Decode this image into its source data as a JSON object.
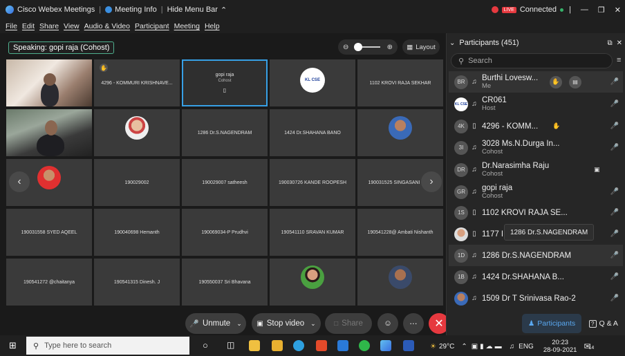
{
  "titlebar": {
    "app": "Cisco Webex Meetings",
    "meeting_info": "Meeting Info",
    "hide_menu": "Hide Menu Bar",
    "rec_badge": "LIVE",
    "status": "Connected"
  },
  "menu": [
    "File",
    "Edit",
    "Share",
    "View",
    "Audio & Video",
    "Participant",
    "Meeting",
    "Help"
  ],
  "speaking": "Speaking: gopi raja (Cohost)",
  "layout_label": "Layout",
  "tiles": [
    {
      "name": "",
      "kind": "video1"
    },
    {
      "name": "4296 - KOMMURI KRISHNAVE...",
      "kind": "name"
    },
    {
      "name": "gopi raja",
      "sub": "Cohost",
      "kind": "active"
    },
    {
      "name": "",
      "kind": "logo"
    },
    {
      "name": "1102 KROVI RAJA SEKHAR",
      "kind": "name"
    },
    {
      "name": "",
      "kind": "video2"
    },
    {
      "name": "",
      "kind": "avatar"
    },
    {
      "name": "1286 Dr.S.NAGENDRAM",
      "kind": "name"
    },
    {
      "name": "1424 Dr.SHAHANA BANO",
      "kind": "name"
    },
    {
      "name": "",
      "kind": "avatar"
    },
    {
      "name": "",
      "kind": "avatar"
    },
    {
      "name": "190029002",
      "kind": "name"
    },
    {
      "name": "190029007 satheesh",
      "kind": "name"
    },
    {
      "name": "190030726 KANDE ROOPESH",
      "kind": "name"
    },
    {
      "name": "190031525 SINGASANI",
      "kind": "name"
    },
    {
      "name": "190031558 SYED AQEEL",
      "kind": "name"
    },
    {
      "name": "190040698 Hemanth",
      "kind": "name"
    },
    {
      "name": "190069034-P Prudhvi",
      "kind": "name"
    },
    {
      "name": "190541110 SRAVAN KUMAR",
      "kind": "name"
    },
    {
      "name": "190541228@ Ambati Nishanth",
      "kind": "name"
    },
    {
      "name": "190541272 @chaitanya",
      "kind": "name"
    },
    {
      "name": "190541315 Dinesh. J",
      "kind": "name"
    },
    {
      "name": "190550037 Sri Bhavana",
      "kind": "name"
    },
    {
      "name": "",
      "kind": "avatar"
    },
    {
      "name": "",
      "kind": "avatar"
    }
  ],
  "logo_text": "KL CSE",
  "controls": {
    "unmute": "Unmute",
    "stop_video": "Stop video",
    "share": "Share"
  },
  "panel": {
    "title": "Participants (451)",
    "search_placeholder": "Search",
    "participants": [
      {
        "initials": "BR",
        "name": "Burthi Lovesw...",
        "sub": "Me",
        "device": "headset",
        "mic": "muted"
      },
      {
        "initials": "CR",
        "name": "CR061",
        "sub": "Host",
        "device": "headset",
        "mic": "muted"
      },
      {
        "initials": "4K",
        "name": "4296 - KOMM...",
        "sub": "",
        "device": "phone",
        "mic": "muted"
      },
      {
        "initials": "3I",
        "name": "3028 Ms.N.Durga In...",
        "sub": "Cohost",
        "device": "headset",
        "mic": "muted"
      },
      {
        "initials": "DR",
        "name": "Dr.Narasimha Raju",
        "sub": "Cohost",
        "device": "headset",
        "mic": "none"
      },
      {
        "initials": "GR",
        "name": "gopi raja",
        "sub": "Cohost",
        "device": "headset",
        "mic": "active"
      },
      {
        "initials": "1S",
        "name": "1102 KROVI RAJA SE...",
        "sub": "",
        "device": "phone",
        "mic": "muted"
      },
      {
        "initials": "",
        "name": "1177 I",
        "sub": "",
        "device": "phone",
        "mic": "muted"
      },
      {
        "initials": "1D",
        "name": "1286 Dr.S.NAGENDRAM",
        "sub": "",
        "device": "headset",
        "mic": "muted"
      },
      {
        "initials": "1B",
        "name": "1424 Dr.SHAHANA B...",
        "sub": "",
        "device": "headset",
        "mic": "muted"
      },
      {
        "initials": "",
        "name": "1509 Dr T Srinivasa Rao-2",
        "sub": "",
        "device": "headset",
        "mic": "muted"
      }
    ],
    "tooltip": "1286 Dr.S.NAGENDRAM",
    "participants_btn": "Participants",
    "qa_btn": "Q & A"
  },
  "taskbar": {
    "search_placeholder": "Type here to search",
    "temperature": "29°C",
    "lang": "ENG",
    "time": "20:23",
    "date": "28-09-2021",
    "notif_count": "14"
  },
  "colors": {
    "accent": "#37a0e6",
    "live": "#e6393f",
    "active_green": "#36b36a"
  }
}
